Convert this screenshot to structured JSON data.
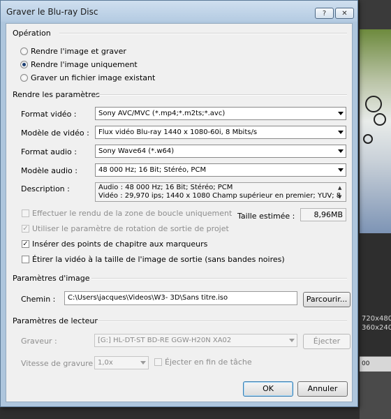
{
  "background": {
    "resolution_1": "720x480",
    "resolution_2": "360x240",
    "ruler_label": "00"
  },
  "dialog": {
    "title": "Graver le Blu-ray Disc",
    "help_label": "?",
    "close_label": "✕"
  },
  "operation": {
    "heading": "Opération",
    "options": [
      {
        "label": "Rendre l'image et graver",
        "selected": false
      },
      {
        "label": "Rendre l'image uniquement",
        "selected": true
      },
      {
        "label": "Graver un fichier image existant",
        "selected": false
      }
    ]
  },
  "render": {
    "heading": "Rendre les paramètres",
    "video_format_label": "Format vidéo :",
    "video_format_value": "Sony AVC/MVC (*.mp4;*.m2ts;*.avc)",
    "video_template_label": "Modèle de vidéo :",
    "video_template_value": "Flux vidéo Blu-ray 1440 x 1080-60i, 8 Mbits/s",
    "audio_format_label": "Format audio :",
    "audio_format_value": "Sony Wave64 (*.w64)",
    "audio_template_label": "Modèle audio :",
    "audio_template_value": "48 000 Hz; 16 Bit; Stéréo, PCM",
    "description_label": "Description :",
    "description_line1": "Audio : 48 000 Hz; 16 Bit; Stéréo; PCM",
    "description_line2": "Vidéo : 29,970 ips; 1440 x 1080 Champ supérieur en premier; YUV; 8",
    "scroll_up": "▲",
    "scroll_down": "▼",
    "loop_label": "Effectuer le rendu de la zone de boucle uniquement",
    "rotation_label": "Utiliser le paramètre de rotation de sortie de projet",
    "chapters_label": "Insérer des points de chapitre aux marqueurs",
    "stretch_label": "Étirer la vidéo à la taille de l'image de sortie (sans bandes noires)",
    "check_mark": "✓",
    "estimated_size_label": "Taille estimée :",
    "estimated_size_value": "8,96MB"
  },
  "image_params": {
    "heading": "Paramètres d'image",
    "path_label": "Chemin :",
    "path_value": "C:\\Users\\jacques\\Videos\\W3- 3D\\Sans titre.iso",
    "browse_label": "Parcourir..."
  },
  "reader_params": {
    "heading": "Paramètres de lecteur",
    "burner_label": "Graveur :",
    "burner_value": "[G:] HL-DT-ST BD-RE  GGW-H20N XA02",
    "eject_label": "Éjecter",
    "speed_label": "Vitesse de gravure :",
    "speed_value": "1,0x",
    "eject_end_label": "Éjecter en fin de tâche"
  },
  "footer": {
    "ok_label": "OK",
    "cancel_label": "Annuler"
  }
}
